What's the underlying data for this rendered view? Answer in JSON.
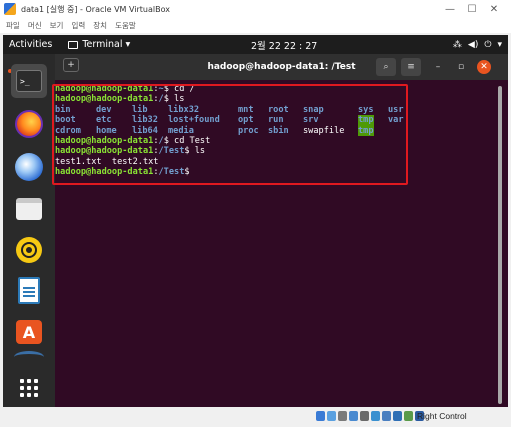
{
  "vbox": {
    "title": "data1 [실행 중] - Oracle VM VirtualBox",
    "menu": [
      "파일",
      "머신",
      "보기",
      "입력",
      "장치",
      "도움말"
    ],
    "controls": {
      "minimize": "—",
      "maximize": "☐",
      "close": "✕"
    },
    "host_key": "Right Control"
  },
  "gnome": {
    "activities": "Activities",
    "app": "Terminal ▾",
    "clock": "2월 22  22 : 27",
    "tray": {
      "network": "⁂",
      "sound": "◀)",
      "power": "⏻",
      "menu": "▾"
    }
  },
  "terminal": {
    "title": "hadoop@hadoop-data1: /Test",
    "new_tab": "+",
    "search": "⌕",
    "menu": "≡",
    "minimize": "–",
    "maximize": "▫",
    "close": "✕",
    "lines": {
      "l1": {
        "user": "hadoop@hadoop-data1",
        "sep": ":",
        "path": "~",
        "cmd": "$ cd /"
      },
      "l2": {
        "user": "hadoop@hadoop-data1",
        "sep": ":",
        "path": "/",
        "cmd": "$ ls"
      },
      "ls_row1": [
        "bin",
        "dev",
        "lib",
        "libx32",
        "mnt",
        "root",
        "snap",
        "sys",
        "usr"
      ],
      "ls_row2": [
        "boot",
        "etc",
        "lib32",
        "lost+found",
        "opt",
        "run",
        "srv",
        "tmp",
        "var"
      ],
      "ls_row3": [
        "cdrom",
        "home",
        "lib64",
        "media",
        "proc",
        "sbin",
        "swapfile",
        "tmp"
      ],
      "l6": {
        "user": "hadoop@hadoop-data1",
        "sep": ":",
        "path": "/",
        "cmd": "$ cd Test"
      },
      "l7": {
        "user": "hadoop@hadoop-data1",
        "sep": ":",
        "path": "/Test",
        "cmd": "$ ls"
      },
      "l8": "test1.txt  test2.txt",
      "l9": {
        "user": "hadoop@hadoop-data1",
        "sep": ":",
        "path": "/Test",
        "cmd": "$"
      }
    }
  },
  "colors": {
    "terminal_bg": "#300a24",
    "prompt_user": "#8ae234",
    "prompt_path": "#729fcf",
    "highlight_box": "#e0191f",
    "ubuntu_orange": "#e95420"
  }
}
